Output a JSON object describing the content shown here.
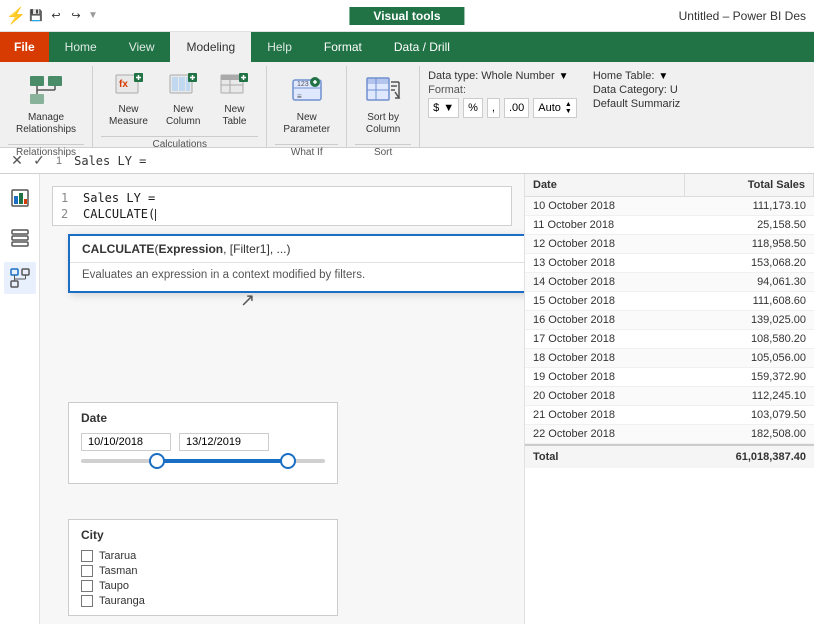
{
  "titleBar": {
    "appTitle": "Untitled – Power BI Des",
    "visualTools": "Visual tools"
  },
  "quickAccess": {
    "save": "💾",
    "undo": "↩",
    "redo": "↪",
    "separator": "|"
  },
  "ribbonTabs": [
    {
      "id": "file",
      "label": "File",
      "active": false
    },
    {
      "id": "home",
      "label": "Home",
      "active": false
    },
    {
      "id": "view",
      "label": "View",
      "active": false
    },
    {
      "id": "modeling",
      "label": "Modeling",
      "active": true
    },
    {
      "id": "help",
      "label": "Help",
      "active": false
    },
    {
      "id": "format",
      "label": "Format",
      "active": false
    },
    {
      "id": "datadrill",
      "label": "Data / Drill",
      "active": false
    }
  ],
  "ribbonGroups": {
    "relationships": {
      "label": "Relationships",
      "buttons": [
        {
          "id": "manage-relationships",
          "label": "Manage\nRelationships",
          "icon": "grid"
        }
      ]
    },
    "calculations": {
      "label": "Calculations",
      "buttons": [
        {
          "id": "new-measure",
          "label": "New\nMeasure",
          "icon": "calc"
        },
        {
          "id": "new-column",
          "label": "New\nColumn",
          "icon": "col"
        },
        {
          "id": "new-table",
          "label": "New\nTable",
          "icon": "table"
        }
      ]
    },
    "whatif": {
      "label": "What If",
      "buttons": [
        {
          "id": "new-parameter",
          "label": "New\nParameter",
          "icon": "param"
        }
      ]
    },
    "sort": {
      "label": "Sort",
      "buttons": [
        {
          "id": "sort-by-column",
          "label": "Sort by\nColumn",
          "icon": "sort"
        }
      ]
    }
  },
  "formattingPanel": {
    "dataTypeLabel": "Data type: Whole Number",
    "formatLabel": "Format:",
    "currencySymbol": "$",
    "percentSymbol": "%",
    "commaSymbol": ",",
    "decimalSymbol": ".00",
    "autoLabel": "Auto",
    "homeTableLabel": "Home Table:",
    "dataCategoryLabel": "Data Category: U",
    "defaultSummarizeLabel": "Default Summariz"
  },
  "formulaBar": {
    "crossBtn": "✕",
    "checkBtn": "✓",
    "lineNum1": "1",
    "line1": "Sales LY =",
    "lineNum2": "2",
    "line2": "CALCULATE("
  },
  "autocomplete": {
    "header": "CALCULATE(Expression, [Filter1], ...)",
    "funcName": "CALCULATE",
    "body": "Evaluates an expression in a context modified by filters."
  },
  "tableData": {
    "colDate": "Date",
    "colSales": "Total Sales",
    "rows": [
      {
        "date": "10 October 2018",
        "sales": "111,173.10"
      },
      {
        "date": "11 October 2018",
        "sales": "25,158.50"
      },
      {
        "date": "12 October 2018",
        "sales": "118,958.50"
      },
      {
        "date": "13 October 2018",
        "sales": "153,068.20"
      },
      {
        "date": "14 October 2018",
        "sales": "94,061.30"
      },
      {
        "date": "15 October 2018",
        "sales": "111,608.60"
      },
      {
        "date": "16 October 2018",
        "sales": "139,025.00"
      },
      {
        "date": "17 October 2018",
        "sales": "108,580.20"
      },
      {
        "date": "18 October 2018",
        "sales": "105,056.00"
      },
      {
        "date": "19 October 2018",
        "sales": "159,372.90"
      },
      {
        "date": "20 October 2018",
        "sales": "112,245.10"
      },
      {
        "date": "21 October 2018",
        "sales": "103,079.50"
      },
      {
        "date": "22 October 2018",
        "sales": "182,508.00"
      }
    ],
    "totalLabel": "Total",
    "totalSales": "61,018,387.40"
  },
  "dateSlicer": {
    "title": "Date",
    "startDate": "10/10/2018",
    "endDate": "13/12/2019"
  },
  "citySlicer": {
    "title": "City",
    "cities": [
      "Tararua",
      "Tasman",
      "Taupo",
      "Tauranga"
    ]
  }
}
